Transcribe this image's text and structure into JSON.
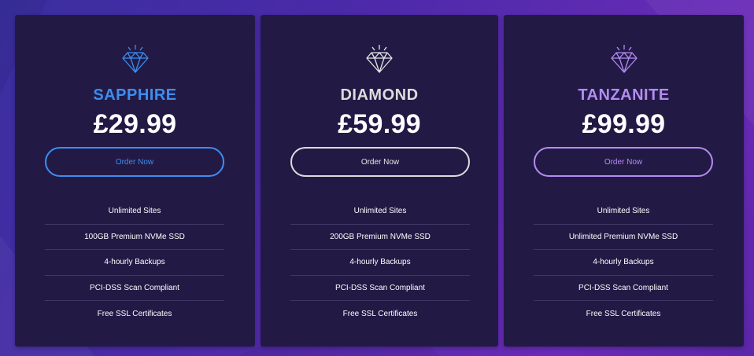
{
  "colors": {
    "sapphire": "#3d8ef0",
    "diamond": "#dcdcdc",
    "tanzanite": "#b48cf2",
    "card_background": "#221a45"
  },
  "plans": [
    {
      "icon": "diamond-icon",
      "name": "SAPPHIRE",
      "price": "£29.99",
      "button_label": "Order Now",
      "features": [
        "Unlimited Sites",
        "100GB Premium NVMe SSD",
        "4-hourly Backups",
        "PCI-DSS Scan Compliant",
        "Free SSL Certificates"
      ]
    },
    {
      "icon": "diamond-icon",
      "name": "DIAMOND",
      "price": "£59.99",
      "button_label": "Order Now",
      "features": [
        "Unlimited Sites",
        "200GB Premium NVMe SSD",
        "4-hourly Backups",
        "PCI-DSS Scan Compliant",
        "Free SSL Certificates"
      ]
    },
    {
      "icon": "diamond-icon",
      "name": "TANZANITE",
      "price": "£99.99",
      "button_label": "Order Now",
      "features": [
        "Unlimited Sites",
        "Unlimited Premium NVMe SSD",
        "4-hourly Backups",
        "PCI-DSS Scan Compliant",
        "Free SSL Certificates"
      ]
    }
  ]
}
